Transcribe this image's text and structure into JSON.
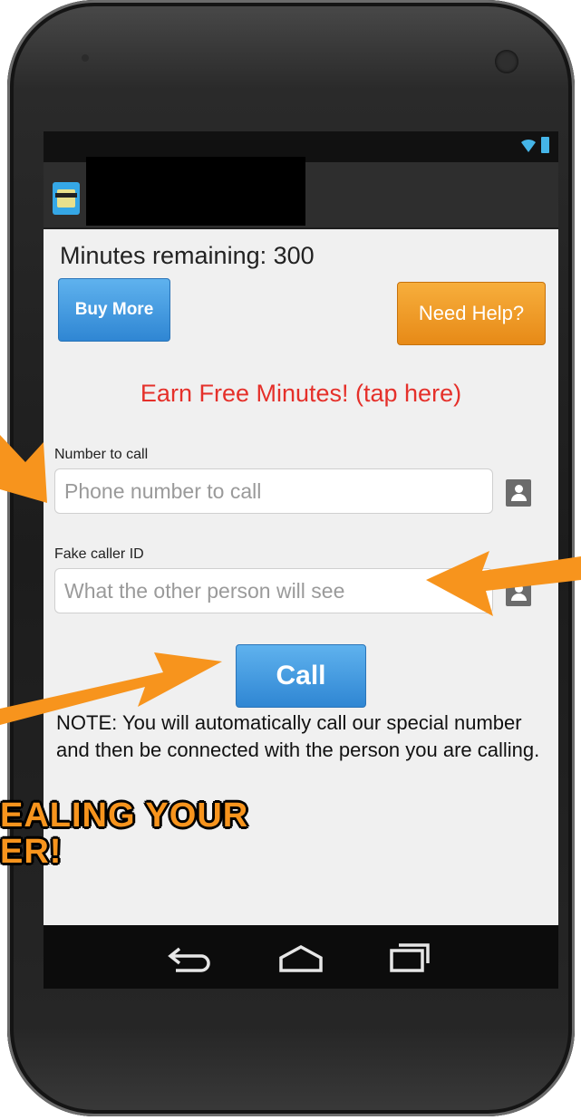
{
  "colors": {
    "accent_blue": "#2f86d3",
    "accent_orange": "#e78a17",
    "earn_red": "#e5302a",
    "arrow_orange": "#f7941d"
  },
  "status_bar": {
    "icons": [
      "wifi-icon",
      "battery-icon"
    ]
  },
  "action_bar": {
    "app_icon": "app-icon",
    "title_redacted": true
  },
  "main": {
    "minutes_label": "Minutes remaining: 300",
    "buy_more_label": "Buy More",
    "need_help_label": "Need Help?",
    "earn_free_label": "Earn Free Minutes! (tap here)",
    "number_to_call": {
      "label": "Number to call",
      "placeholder": "Phone number to call",
      "value": ""
    },
    "fake_caller_id": {
      "label": "Fake caller ID",
      "placeholder": "What the other person will see",
      "value": ""
    },
    "call_label": "Call",
    "note": "NOTE: You will automatically call our special number and then be connected with the person you are calling."
  },
  "nav_bar": {
    "buttons": [
      "back-icon",
      "home-icon",
      "recents-icon"
    ]
  },
  "overlay": {
    "line1": "EALING YOUR",
    "line2": "ER!"
  }
}
